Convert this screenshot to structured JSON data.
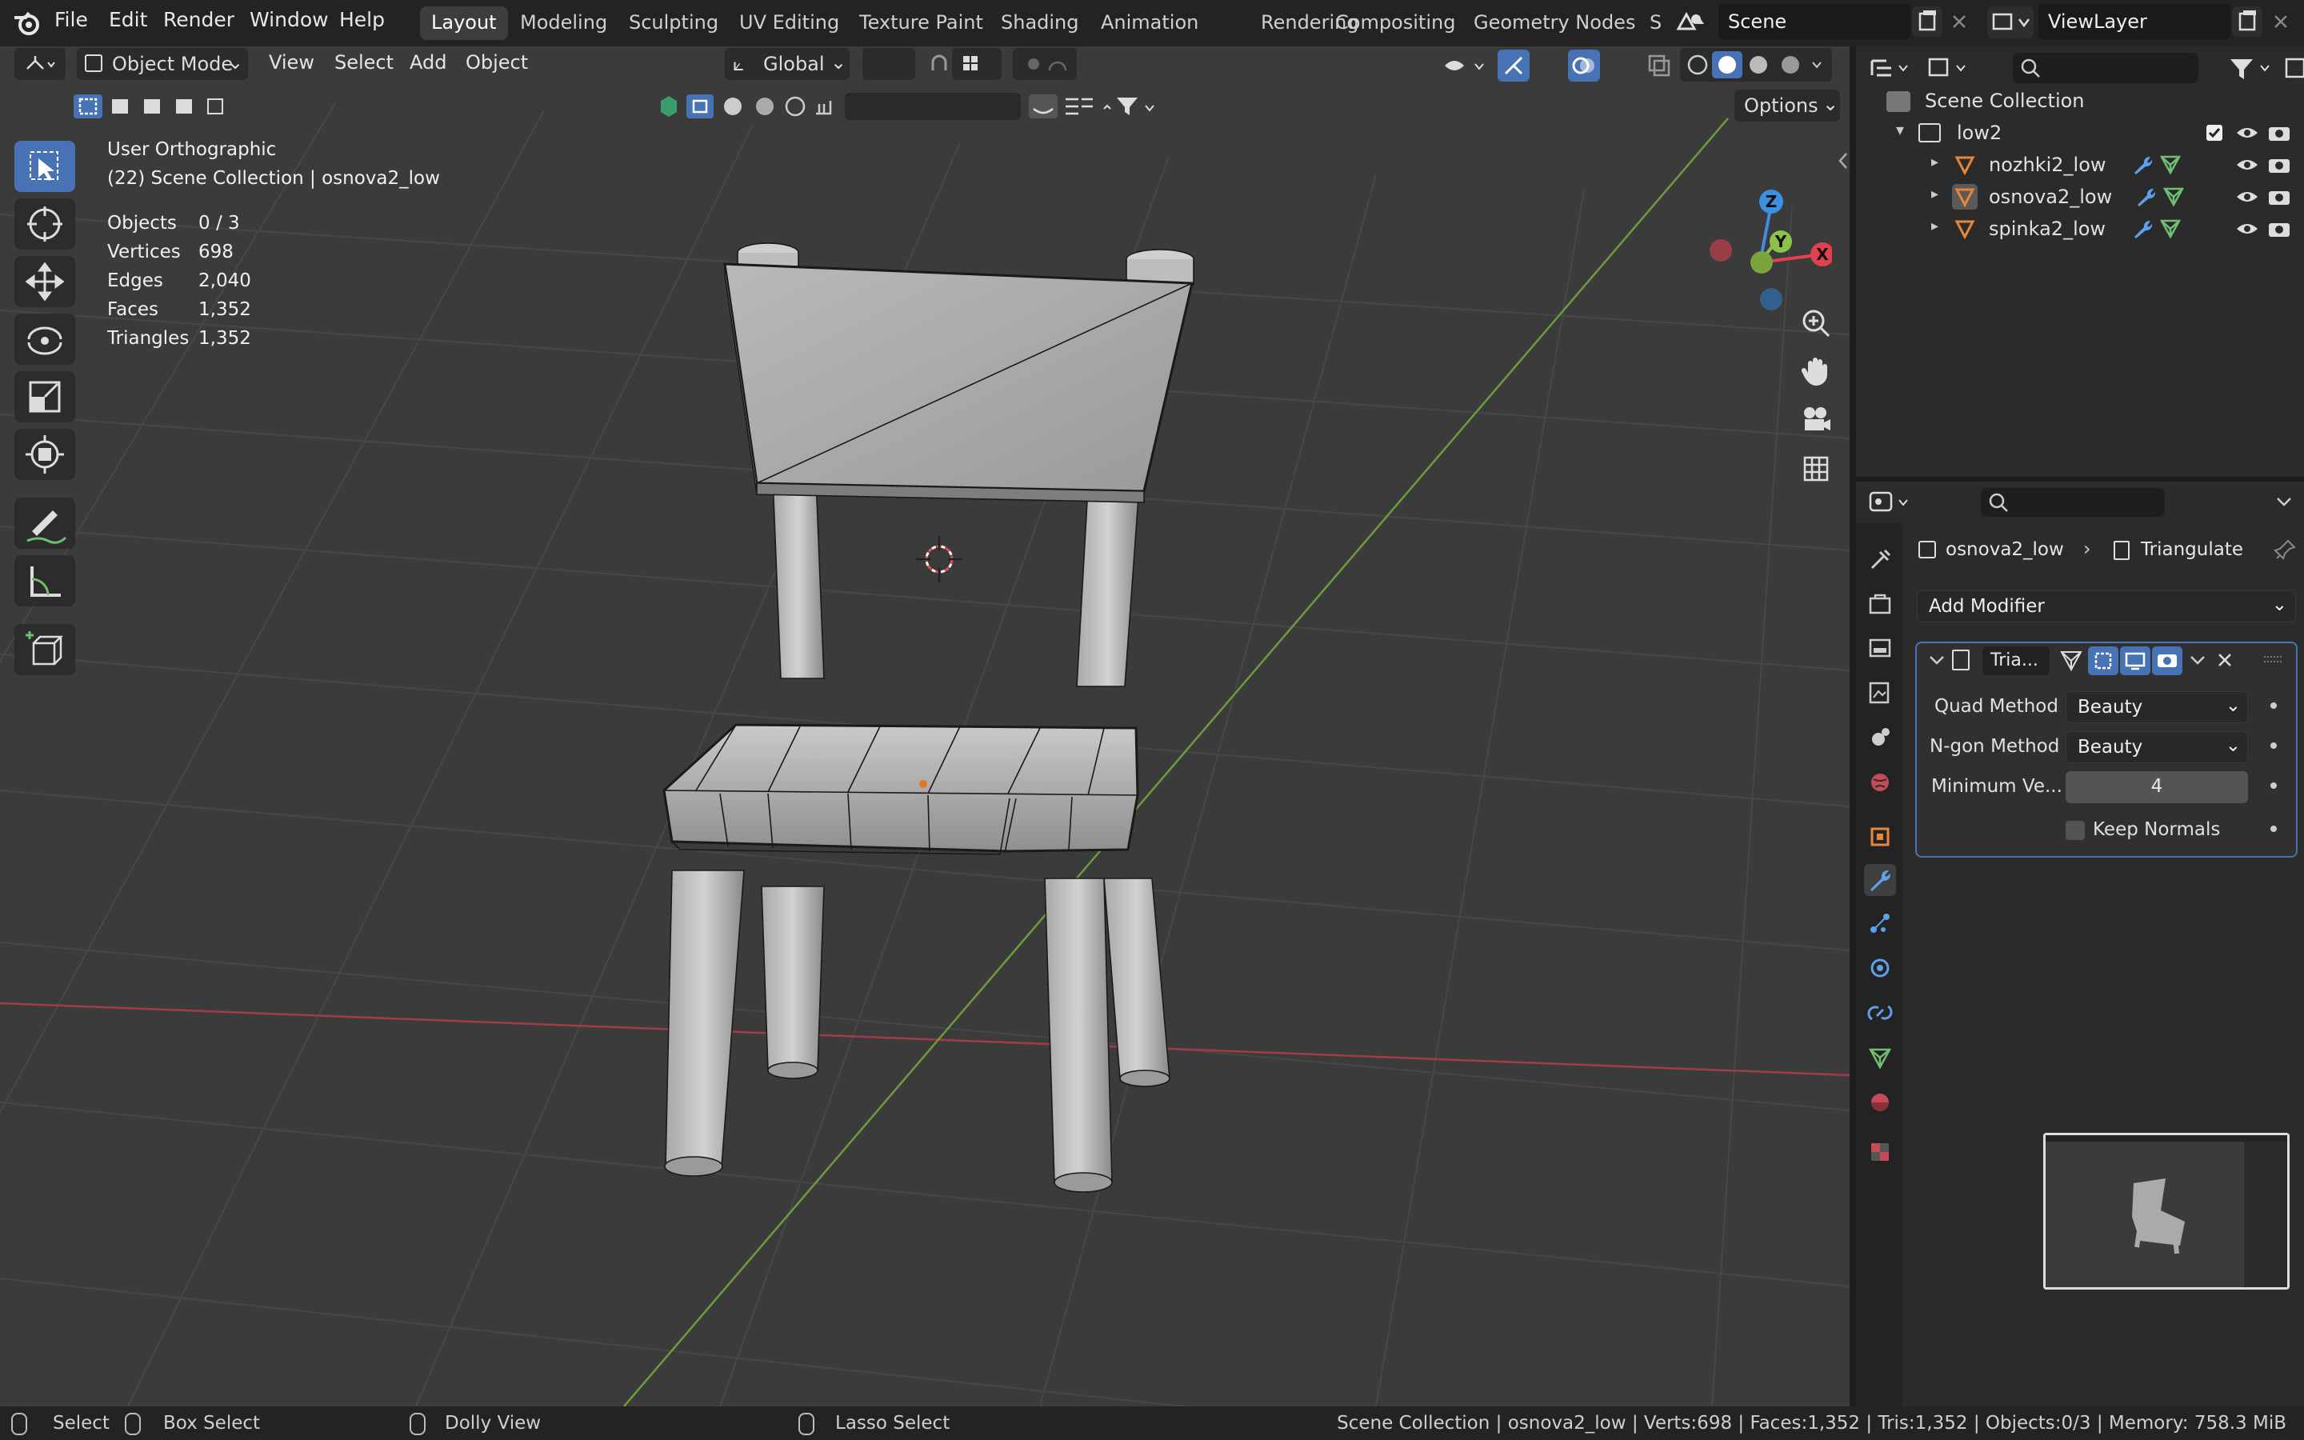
{
  "menubar": {
    "items": [
      "File",
      "Edit",
      "Render",
      "Window",
      "Help"
    ],
    "workspaces": [
      "Layout",
      "Modeling",
      "Sculpting",
      "UV Editing",
      "Texture Paint",
      "Shading",
      "Animation",
      "Rendering",
      "Compositing",
      "Geometry Nodes",
      "S"
    ],
    "active_workspace": "Layout",
    "scene": "Scene",
    "view_layer": "ViewLayer"
  },
  "viewport": {
    "mode": "Object Mode",
    "menus": [
      "View",
      "Select",
      "Add",
      "Object"
    ],
    "orientation": "Global",
    "options_label": "Options",
    "view_name": "User Orthographic",
    "collection_info": "(22) Scene Collection | osnova2_low",
    "stats": [
      {
        "label": "Objects",
        "value": "0 / 3"
      },
      {
        "label": "Vertices",
        "value": "698"
      },
      {
        "label": "Edges",
        "value": "2,040"
      },
      {
        "label": "Faces",
        "value": "1,352"
      },
      {
        "label": "Triangles",
        "value": "1,352"
      }
    ],
    "gizmo": {
      "z": "Z",
      "y": "Y",
      "x": "X"
    },
    "colors": {
      "x_axis": "#e0404f",
      "y_axis": "#8bc34a",
      "z_axis": "#3d8fe0",
      "background": "#3b3b3b",
      "grid": "#4a4a4a"
    }
  },
  "outliner": {
    "root": "Scene Collection",
    "collection": "low2",
    "objects": [
      "nozhki2_low",
      "osnova2_low",
      "spinka2_low"
    ]
  },
  "properties": {
    "breadcrumb_object": "osnova2_low",
    "breadcrumb_modifier": "Triangulate",
    "add_modifier": "Add Modifier",
    "modifier_name": "Tria...",
    "fields": {
      "quad_method_label": "Quad Method",
      "quad_method_value": "Beauty",
      "ngon_method_label": "N-gon Method",
      "ngon_method_value": "Beauty",
      "min_verts_label": "Minimum Ve...",
      "min_verts_value": "4",
      "keep_normals_label": "Keep Normals"
    }
  },
  "statusbar": {
    "select": "Select",
    "box_select": "Box Select",
    "dolly": "Dolly View",
    "lasso": "Lasso Select",
    "info": "Scene Collection | osnova2_low | Verts:698 | Faces:1,352 | Tris:1,352 | Objects:0/3 | Memory: 758.3 MiB"
  }
}
